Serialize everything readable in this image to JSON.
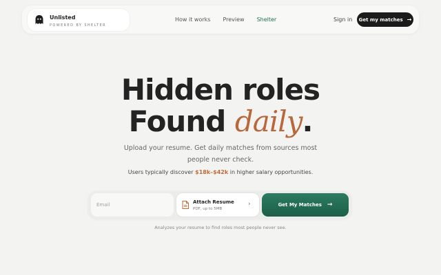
{
  "brand": {
    "name": "Unlisted",
    "subtitle": "POWERED BY SHELTER"
  },
  "nav": {
    "links": [
      {
        "label": "How it works"
      },
      {
        "label": "Preview"
      },
      {
        "label": "Shelter"
      }
    ],
    "sign_in": "Sign in",
    "cta": "Get my matches"
  },
  "hero": {
    "line1": "Hidden roles",
    "line2_prefix": "Found ",
    "line2_accent": "daily",
    "line2_suffix": ".",
    "subtitle_line1": "Upload your resume. Get daily matches from sources most",
    "subtitle_line2": "people never check.",
    "salary_prefix": "Users typically discover ",
    "salary_range": "$18k–$42k",
    "salary_suffix": " in higher salary opportunities."
  },
  "form": {
    "email_placeholder": "Email",
    "attach_title": "Attach Resume",
    "attach_subtitle": "PDF, up to 5MB",
    "submit_label": "Get My Matches",
    "note": "Analyzes your resume to find roles most people never see."
  },
  "colors": {
    "accent_green": "#1f6e54",
    "accent_orange": "#b8683a",
    "dark": "#1b1b1b"
  }
}
